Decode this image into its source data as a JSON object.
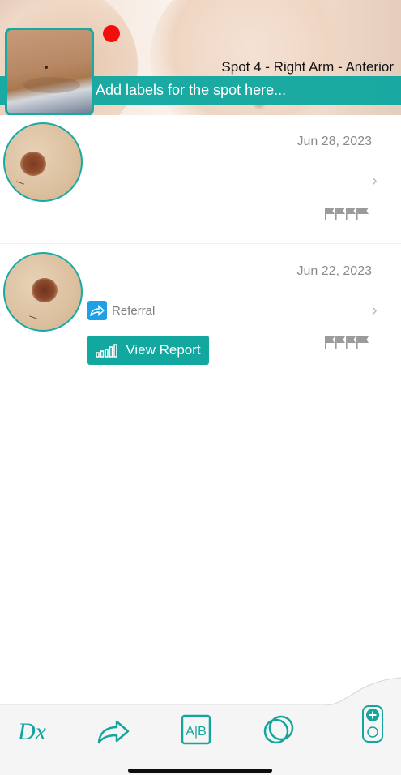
{
  "header": {
    "spot_title": "Spot 4 - Right Arm - Anterior",
    "label_placeholder": "Add labels for the spot here...",
    "marker_color": "#f40d0d",
    "accent_color": "#12a8a0"
  },
  "entries": [
    {
      "date": "Jun 28, 2023",
      "referral_label": null,
      "report_label": null,
      "flag_count": 4
    },
    {
      "date": "Jun 22, 2023",
      "referral_label": "Referral",
      "report_label": "View Report",
      "flag_count": 4
    }
  ],
  "toolbar": {
    "items": [
      {
        "name": "dx-icon",
        "label": "Dx"
      },
      {
        "name": "share-icon"
      },
      {
        "name": "compare-ab-icon",
        "label": "A|B"
      },
      {
        "name": "overlap-circles-icon"
      },
      {
        "name": "add-capture-icon"
      }
    ]
  }
}
